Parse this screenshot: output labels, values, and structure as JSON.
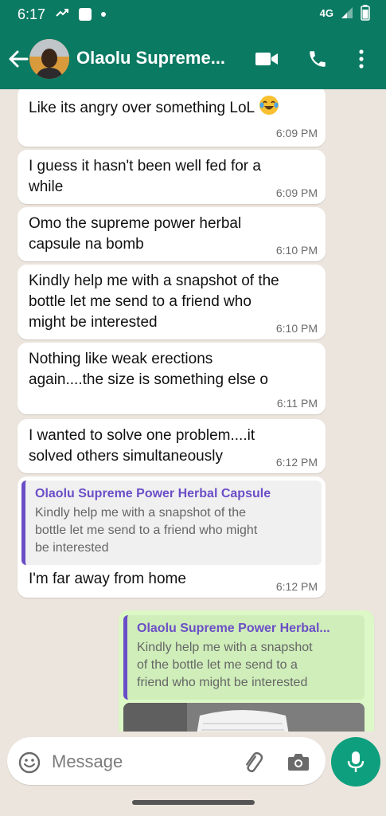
{
  "status_bar": {
    "time": "6:17",
    "network": "4G",
    "battery_level": "72"
  },
  "header": {
    "contact_name": "Olaolu Supreme...",
    "icons": [
      "back-arrow-icon",
      "video-call-icon",
      "phone-icon",
      "more-options-icon"
    ]
  },
  "messages": [
    {
      "text": "Like its angry over something LoL",
      "emoji": "laughing-tears-emoji",
      "time": "6:09 PM"
    },
    {
      "lines": [
        "I guess it hasn't been well fed for a",
        "while"
      ],
      "time": "6:09 PM"
    },
    {
      "lines": [
        "Omo the supreme power herbal",
        "capsule na bomb"
      ],
      "time": "6:10 PM"
    },
    {
      "lines": [
        "Kindly help me with a snapshot of the",
        "bottle let me send to a friend who",
        "might be interested"
      ],
      "time": "6:10 PM"
    },
    {
      "lines": [
        "Nothing like weak erections",
        "again....the size is something else o"
      ],
      "time": "6:11 PM"
    },
    {
      "lines": [
        "I wanted to solve one problem....it",
        "solved others simultaneously"
      ],
      "time": "6:12 PM"
    },
    {
      "quote": {
        "name": "Olaolu Supreme Power Herbal Capsule",
        "lines": [
          "Kindly help me with a snapshot of the",
          "bottle let me send to a friend who might",
          "be interested"
        ]
      },
      "text": "I'm far away from home",
      "time": "6:12 PM"
    }
  ],
  "outgoing": {
    "quote": {
      "name": "Olaolu Supreme Power Herbal...",
      "lines": [
        "Kindly help me with a snapshot",
        "of the bottle let me send to a",
        "friend who might be interested"
      ]
    }
  },
  "input": {
    "placeholder": "Message"
  },
  "colors": {
    "header": "#0b7a63",
    "chat_background": "#ece5dd",
    "incoming_bubble": "#ffffff",
    "outgoing_bubble": "#dcf8c6",
    "quote_accent": "#6b4ec7",
    "mic_button": "#0e9f7e"
  }
}
